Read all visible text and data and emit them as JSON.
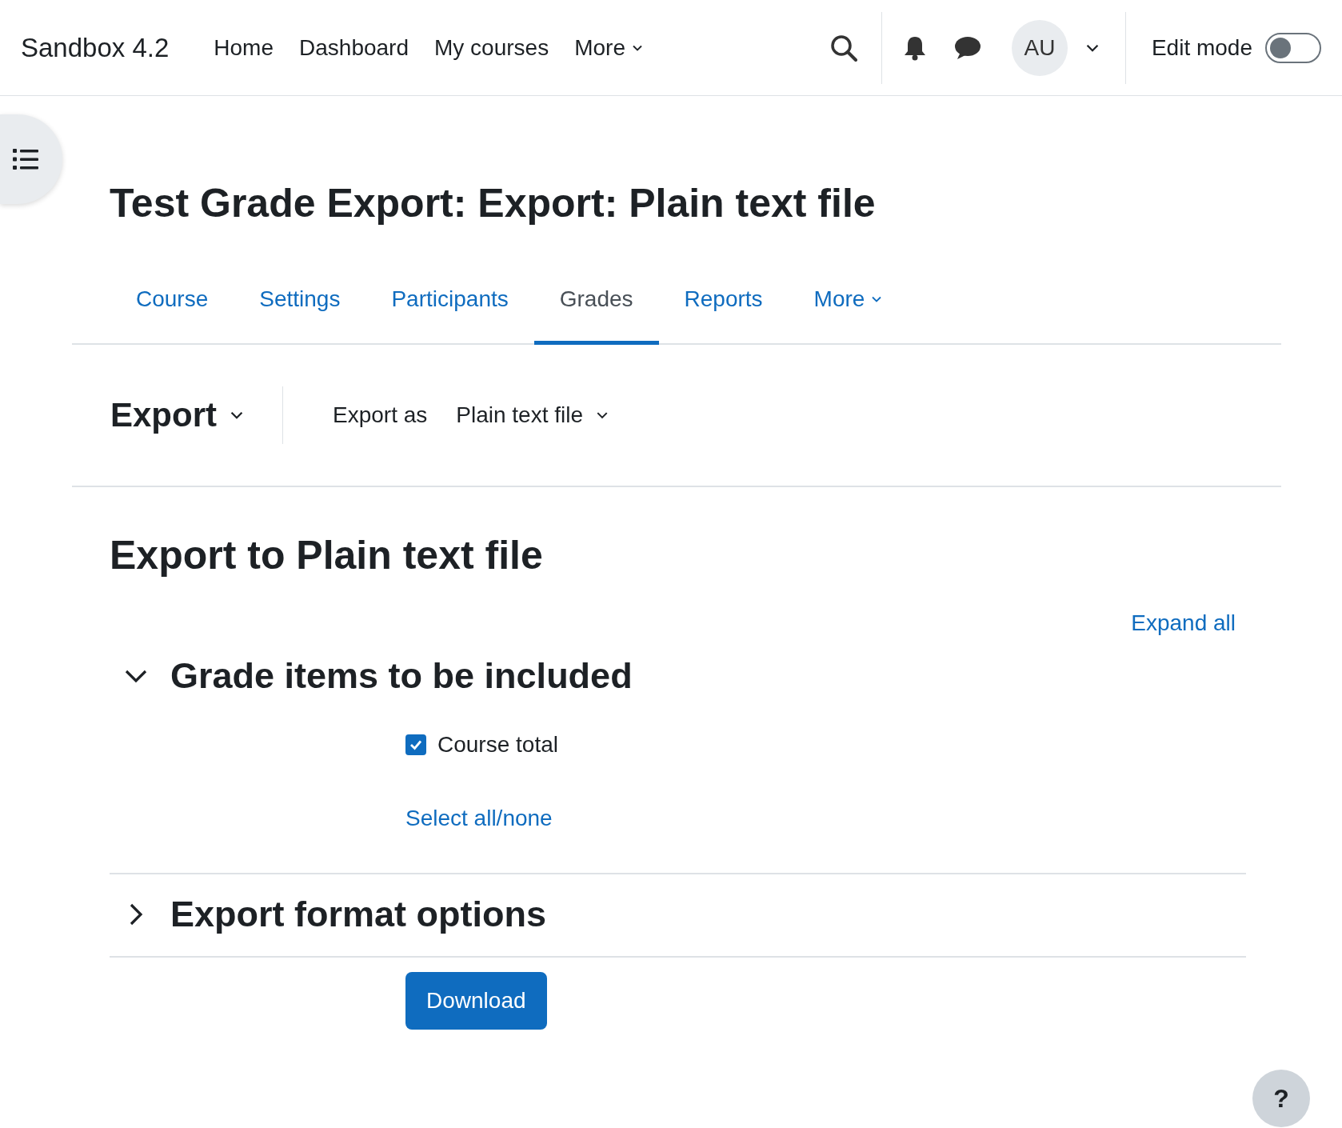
{
  "header": {
    "brand": "Sandbox 4.2",
    "nav": [
      {
        "label": "Home",
        "kind": "link"
      },
      {
        "label": "Dashboard",
        "kind": "link"
      },
      {
        "label": "My courses",
        "kind": "link"
      },
      {
        "label": "More",
        "kind": "dropdown"
      }
    ],
    "avatar": "AU",
    "edit_mode": {
      "label": "Edit mode",
      "on": false
    }
  },
  "page_title": "Test Grade Export: Export: Plain text file",
  "tabs": [
    {
      "label": "Course",
      "selected": false,
      "kind": "link"
    },
    {
      "label": "Settings",
      "selected": false,
      "kind": "link"
    },
    {
      "label": "Participants",
      "selected": false,
      "kind": "link"
    },
    {
      "label": "Grades",
      "selected": true,
      "kind": "link"
    },
    {
      "label": "Reports",
      "selected": false,
      "kind": "link"
    },
    {
      "label": "More",
      "selected": false,
      "kind": "dropdown"
    }
  ],
  "action_bar": {
    "title": "Export",
    "label": "Export as",
    "value": "Plain text file"
  },
  "heading": "Export to Plain text file",
  "expand_all": "Expand all",
  "sections": [
    {
      "title": "Grade items to be included",
      "expanded": true,
      "items": [
        {
          "label": "Course total",
          "checked": true
        }
      ],
      "link": "Select all/none"
    },
    {
      "title": "Export format options",
      "expanded": false
    }
  ],
  "button": "Download",
  "help": "?"
}
